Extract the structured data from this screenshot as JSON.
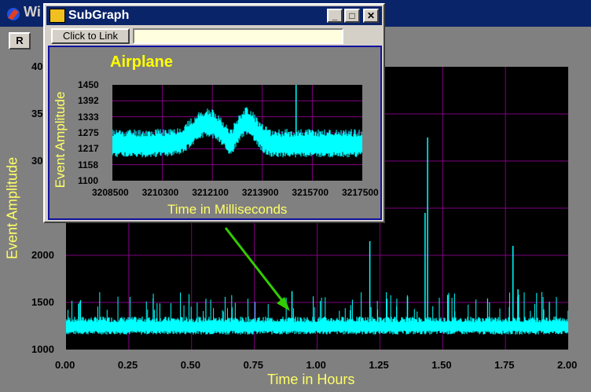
{
  "main_window": {
    "title": "Wi",
    "r_button_label": "R",
    "chart_data": {
      "type": "line",
      "xlabel": "Time in Hours",
      "ylabel": "Event Amplitude",
      "xlim": [
        0,
        2.0
      ],
      "ylim": [
        1000,
        4000
      ],
      "x_ticks": [
        "0.00",
        "0.25",
        "0.50",
        "0.75",
        "1.00",
        "1.25",
        "1.50",
        "1.75",
        "2.00"
      ],
      "y_ticks_visible": [
        "40",
        "35",
        "30",
        "2000",
        "1500",
        "1000"
      ],
      "grid": true,
      "baseline": 1250,
      "spikes": [
        {
          "x": 0.9,
          "y": 1620
        },
        {
          "x": 1.21,
          "y": 2150
        },
        {
          "x": 1.43,
          "y": 2450
        },
        {
          "x": 1.44,
          "y": 3250
        },
        {
          "x": 1.78,
          "y": 2100
        },
        {
          "x": 1.36,
          "y": 1560
        },
        {
          "x": 1.8,
          "y": 1640
        },
        {
          "x": 1.52,
          "y": 1580
        }
      ]
    }
  },
  "subgraph_window": {
    "title": "SubGraph",
    "link_button_label": "Click to Link",
    "link_input_value": "",
    "minimize_label": "_",
    "maximize_label": "□",
    "close_label": "✕",
    "chart_data": {
      "type": "line",
      "title": "Airplane",
      "xlabel": "Time in Milliseconds",
      "ylabel": "Event Amplitude",
      "xlim": [
        3208500,
        3217500
      ],
      "ylim": [
        1100,
        1450
      ],
      "x_ticks": [
        "3208500",
        "3210300",
        "3212100",
        "3213900",
        "3215700",
        "3217500"
      ],
      "y_ticks": [
        "1450",
        "1392",
        "1333",
        "1275",
        "1217",
        "1158",
        "1100"
      ],
      "grid": true
    }
  },
  "colors": {
    "trace": "#00ffff",
    "grid": "#800080",
    "axis_label": "#ffff66",
    "arrow": "#33cc00"
  }
}
